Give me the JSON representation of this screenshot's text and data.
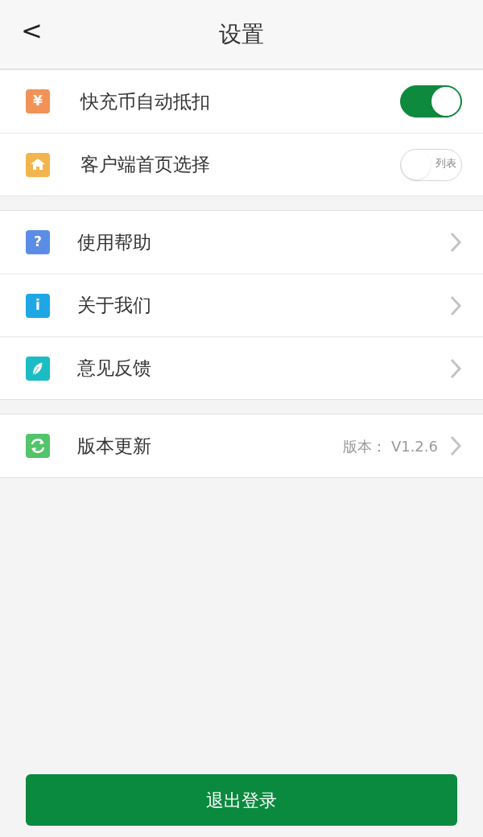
{
  "header": {
    "title": "设置",
    "back": "<"
  },
  "groups": [
    {
      "rows": [
        {
          "kind": "toggle",
          "label": "快充币自动抵扣",
          "glyph": "¥",
          "color": "#f39257",
          "on": true
        },
        {
          "kind": "toggle",
          "label": "客户端首页选择",
          "color": "#f2b54e",
          "on": false,
          "toggle_label": "列表"
        }
      ]
    },
    {
      "rows": [
        {
          "kind": "link",
          "label": "使用帮助",
          "glyph": "?",
          "color": "#5b8de6"
        },
        {
          "kind": "link",
          "label": "关于我们",
          "glyph": "i",
          "color": "#1ea7e4"
        },
        {
          "kind": "link",
          "label": "意见反馈",
          "color": "#1cbcc4"
        }
      ]
    },
    {
      "rows": [
        {
          "kind": "link",
          "label": "版本更新",
          "color": "#52c46a",
          "value": "版本： V1.2.6"
        }
      ]
    }
  ],
  "logout_button": "退出登录"
}
